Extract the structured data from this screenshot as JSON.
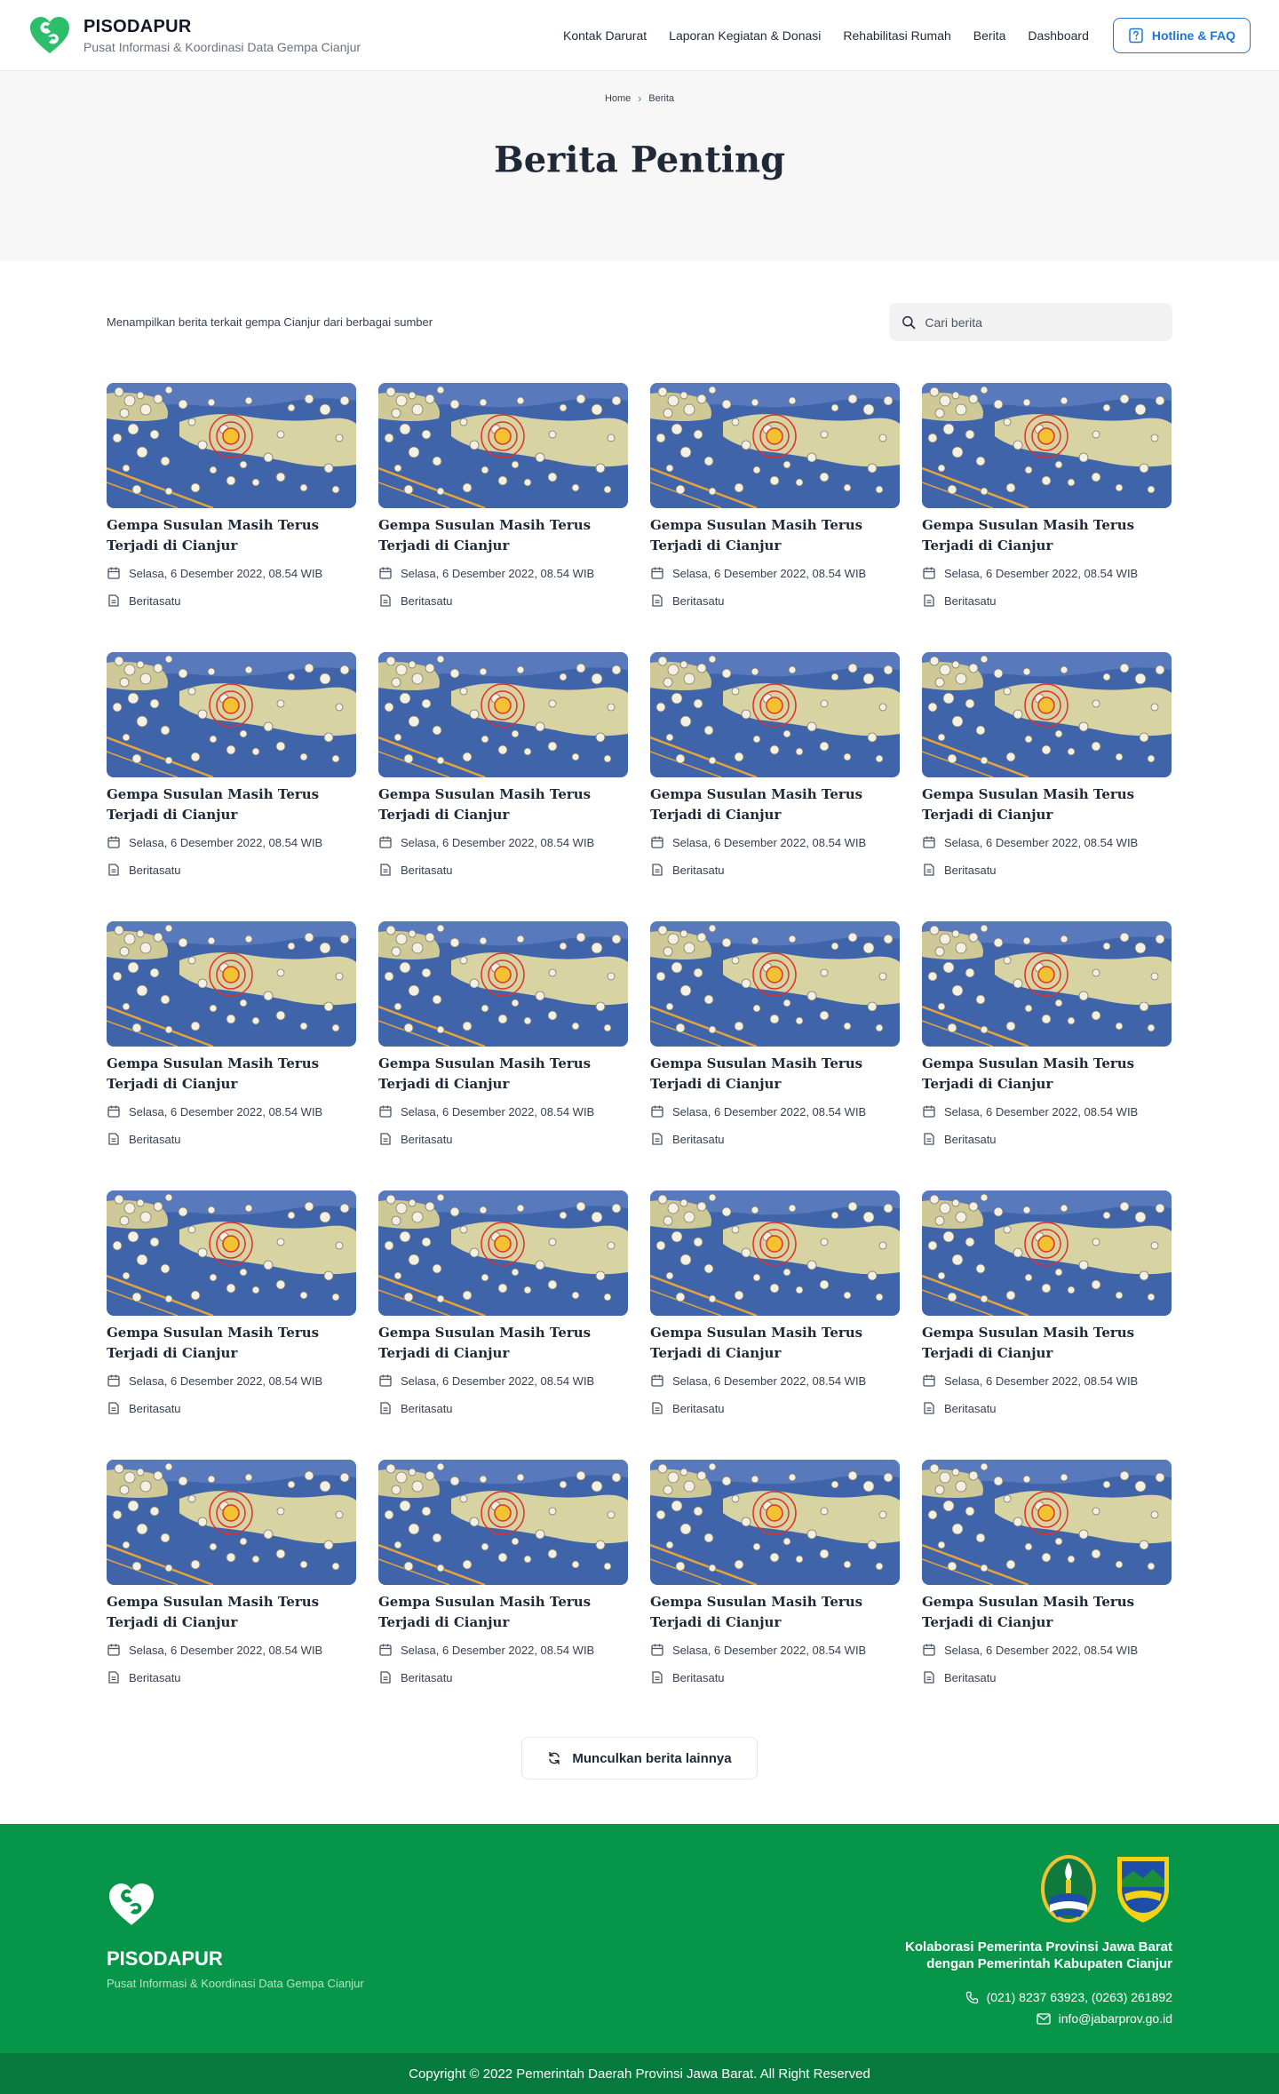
{
  "header": {
    "brand_name": "PISODAPUR",
    "brand_sub": "Pusat Informasi & Koordinasi Data Gempa Cianjur",
    "nav": [
      "Kontak Darurat",
      "Laporan Kegiatan & Donasi",
      "Rehabilitasi Rumah",
      "Berita",
      "Dashboard"
    ],
    "hotline_label": "Hotline & FAQ",
    "brand_color": "#2cbf6b",
    "accent_color": "#1e75d9"
  },
  "breadcrumb": {
    "home": "Home",
    "current": "Berita"
  },
  "hero": {
    "title": "Berita Penting"
  },
  "main": {
    "intro": "Menampilkan berita terkait gempa Cianjur dari berbagai sumber",
    "search_placeholder": "Cari berita"
  },
  "news": [
    {
      "title": "Gempa Susulan Masih Terus Terjadi di Cianjur",
      "date": "Selasa, 6 Desember 2022, 08.54 WIB",
      "source": "Beritasatu"
    },
    {
      "title": "Gempa Susulan Masih Terus Terjadi di Cianjur",
      "date": "Selasa, 6 Desember 2022, 08.54 WIB",
      "source": "Beritasatu"
    },
    {
      "title": "Gempa Susulan Masih Terus Terjadi di Cianjur",
      "date": "Selasa, 6 Desember 2022, 08.54 WIB",
      "source": "Beritasatu"
    },
    {
      "title": "Gempa Susulan Masih Terus Terjadi di Cianjur",
      "date": "Selasa, 6 Desember 2022, 08.54 WIB",
      "source": "Beritasatu"
    },
    {
      "title": "Gempa Susulan Masih Terus Terjadi di Cianjur",
      "date": "Selasa, 6 Desember 2022, 08.54 WIB",
      "source": "Beritasatu"
    },
    {
      "title": "Gempa Susulan Masih Terus Terjadi di Cianjur",
      "date": "Selasa, 6 Desember 2022, 08.54 WIB",
      "source": "Beritasatu"
    },
    {
      "title": "Gempa Susulan Masih Terus Terjadi di Cianjur",
      "date": "Selasa, 6 Desember 2022, 08.54 WIB",
      "source": "Beritasatu"
    },
    {
      "title": "Gempa Susulan Masih Terus Terjadi di Cianjur",
      "date": "Selasa, 6 Desember 2022, 08.54 WIB",
      "source": "Beritasatu"
    },
    {
      "title": "Gempa Susulan Masih Terus Terjadi di Cianjur",
      "date": "Selasa, 6 Desember 2022, 08.54 WIB",
      "source": "Beritasatu"
    },
    {
      "title": "Gempa Susulan Masih Terus Terjadi di Cianjur",
      "date": "Selasa, 6 Desember 2022, 08.54 WIB",
      "source": "Beritasatu"
    },
    {
      "title": "Gempa Susulan Masih Terus Terjadi di Cianjur",
      "date": "Selasa, 6 Desember 2022, 08.54 WIB",
      "source": "Beritasatu"
    },
    {
      "title": "Gempa Susulan Masih Terus Terjadi di Cianjur",
      "date": "Selasa, 6 Desember 2022, 08.54 WIB",
      "source": "Beritasatu"
    },
    {
      "title": "Gempa Susulan Masih Terus Terjadi di Cianjur",
      "date": "Selasa, 6 Desember 2022, 08.54 WIB",
      "source": "Beritasatu"
    },
    {
      "title": "Gempa Susulan Masih Terus Terjadi di Cianjur",
      "date": "Selasa, 6 Desember 2022, 08.54 WIB",
      "source": "Beritasatu"
    },
    {
      "title": "Gempa Susulan Masih Terus Terjadi di Cianjur",
      "date": "Selasa, 6 Desember 2022, 08.54 WIB",
      "source": "Beritasatu"
    },
    {
      "title": "Gempa Susulan Masih Terus Terjadi di Cianjur",
      "date": "Selasa, 6 Desember 2022, 08.54 WIB",
      "source": "Beritasatu"
    },
    {
      "title": "Gempa Susulan Masih Terus Terjadi di Cianjur",
      "date": "Selasa, 6 Desember 2022, 08.54 WIB",
      "source": "Beritasatu"
    },
    {
      "title": "Gempa Susulan Masih Terus Terjadi di Cianjur",
      "date": "Selasa, 6 Desember 2022, 08.54 WIB",
      "source": "Beritasatu"
    },
    {
      "title": "Gempa Susulan Masih Terus Terjadi di Cianjur",
      "date": "Selasa, 6 Desember 2022, 08.54 WIB",
      "source": "Beritasatu"
    },
    {
      "title": "Gempa Susulan Masih Terus Terjadi di Cianjur",
      "date": "Selasa, 6 Desember 2022, 08.54 WIB",
      "source": "Beritasatu"
    }
  ],
  "more_label": "Munculkan berita lainnya",
  "footer": {
    "brand_name": "PISODAPUR",
    "brand_sub": "Pusat Informasi & Koordinasi Data Gempa Cianjur",
    "collab_line1": "Kolaborasi Pemerinta Provinsi Jawa Barat",
    "collab_line2": "dengan Pemerintah Kabupaten Cianjur",
    "phone": "(021) 8237 63923, (0263) 261892",
    "email": "info@jabarprov.go.id",
    "copyright": "Copyright © 2022 Pemerintah Daerah Provinsi Jawa Barat. All Right Reserved",
    "background_color": "#079549"
  }
}
